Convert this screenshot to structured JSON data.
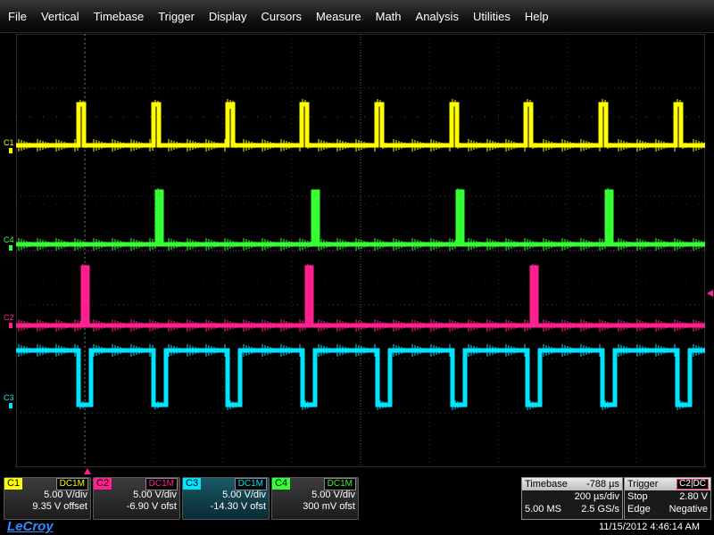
{
  "menu": [
    "File",
    "Vertical",
    "Timebase",
    "Trigger",
    "Display",
    "Cursors",
    "Measure",
    "Math",
    "Analysis",
    "Utilities",
    "Help"
  ],
  "channels": [
    {
      "name": "C1",
      "color": "#ffff00",
      "coupling": "DC1M",
      "vdiv": "5.00 V/div",
      "offset": "9.35 V offset"
    },
    {
      "name": "C2",
      "color": "#ff1f8e",
      "coupling": "DC1M",
      "vdiv": "5.00 V/div",
      "offset": "-6.90 V ofst"
    },
    {
      "name": "C3",
      "color": "#00e5ff",
      "coupling": "DC1M",
      "vdiv": "5.00 V/div",
      "offset": "-14.30 V ofst"
    },
    {
      "name": "C4",
      "color": "#33ff33",
      "coupling": "DC1M",
      "vdiv": "5.00 V/div",
      "offset": "300 mV ofst"
    }
  ],
  "trace_labels": {
    "c1": "C1",
    "c4": "C4",
    "c2": "C2",
    "c3": "C3"
  },
  "timebase": {
    "label": "Timebase",
    "delay": "-788 µs",
    "tdiv": "200 µs/div",
    "samples": "5.00 MS",
    "rate": "2.5 GS/s"
  },
  "trigger": {
    "label": "Trigger",
    "source": "C2",
    "coupling": "DC",
    "mode": "Stop",
    "level": "2.80 V",
    "type": "Edge",
    "slope": "Negative"
  },
  "logo": "LeCroy",
  "timestamp": "11/15/2012 4:46:14 AM",
  "waveforms": {
    "c1_pulses": [
      88,
      172,
      255,
      338,
      422,
      506,
      589,
      673,
      757
    ],
    "c4_pulses": [
      176,
      351,
      513,
      680
    ],
    "c2_pulses": [
      93,
      344,
      596
    ],
    "c3_dips": [
      88,
      172,
      255,
      339,
      423,
      507,
      591,
      675,
      759
    ]
  }
}
